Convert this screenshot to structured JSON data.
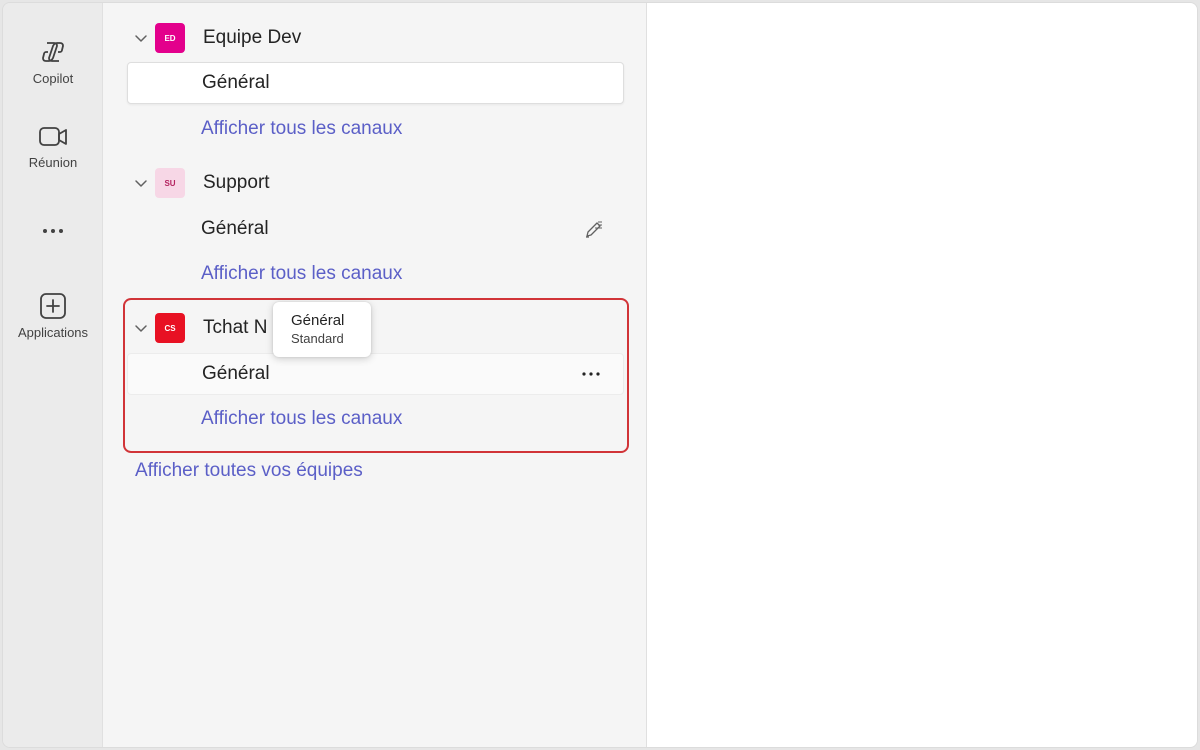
{
  "rail": {
    "items": [
      {
        "label": "Copilot",
        "icon": "copilot-icon"
      },
      {
        "label": "Réunion",
        "icon": "video-camera-icon"
      },
      {
        "label": "",
        "icon": "more-icon"
      },
      {
        "label": "Applications",
        "icon": "add-apps-icon"
      }
    ]
  },
  "teams": [
    {
      "name": "Equipe Dev",
      "initials": "ED",
      "avatar_bg": "#e3008c",
      "avatar_fg": "#ffffff",
      "channel": "Général",
      "show_all": "Afficher tous les canaux"
    },
    {
      "name": "Support",
      "initials": "SU",
      "avatar_bg": "#f7d7e6",
      "avatar_fg": "#b4235f",
      "channel": "Général",
      "show_all": "Afficher tous les canaux"
    },
    {
      "name": "Tchat N",
      "initials": "CS",
      "avatar_bg": "#e81123",
      "avatar_fg": "#ffffff",
      "channel": "Général",
      "show_all": "Afficher tous les canaux"
    }
  ],
  "tooltip": {
    "title": "Général",
    "subtitle": "Standard"
  },
  "show_all_teams": "Afficher toutes vos équipes",
  "colors": {
    "accent": "#5b5fc7",
    "highlight": "#d13438"
  }
}
